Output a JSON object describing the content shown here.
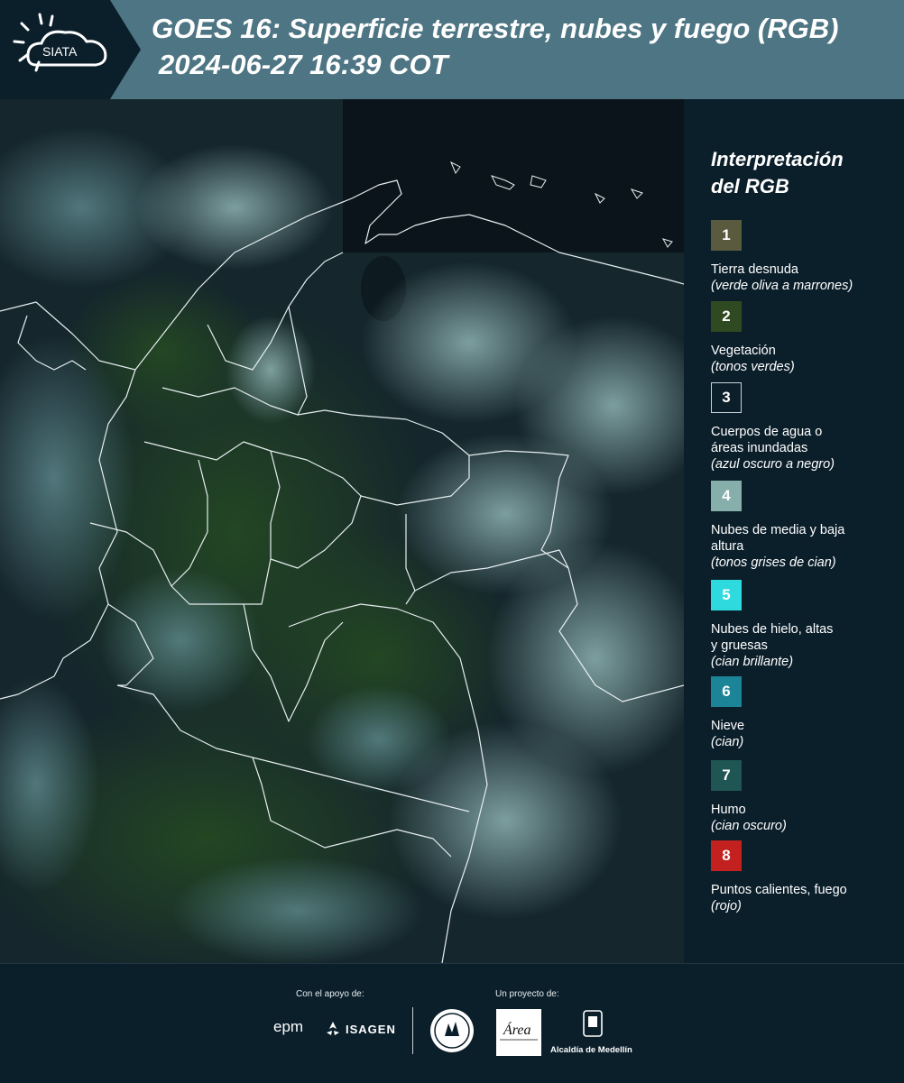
{
  "header": {
    "logo_text": "SIATA",
    "title": "GOES 16: Superficie terrestre, nubes y fuego (RGB)",
    "subtitle": "2024-06-27 16:39 COT"
  },
  "legend": {
    "title_line1": "Interpretación",
    "title_line2": "del RGB",
    "items": [
      {
        "num": "1",
        "label": "Tierra desnuda",
        "desc": "(verde oliva a marrones)",
        "color": "#5a5a3e"
      },
      {
        "num": "2",
        "label": "Vegetación",
        "desc": "(tonos verdes)",
        "color": "#2f4a21"
      },
      {
        "num": "3",
        "label": "Cuerpos de agua o áreas inundadas",
        "desc": "(azul oscuro a negro)",
        "color": "#0b1f2b"
      },
      {
        "num": "4",
        "label": "Nubes de media y baja altura",
        "desc": "(tonos grises de cian)",
        "color": "#86aeab"
      },
      {
        "num": "5",
        "label": "Nubes de hielo, altas y gruesas",
        "desc": "(cian brillante)",
        "color": "#2fdadf"
      },
      {
        "num": "6",
        "label": "Nieve",
        "desc": "(cian)",
        "color": "#1c8497"
      },
      {
        "num": "7",
        "label": "Humo",
        "desc": "(cian oscuro)",
        "color": "#1f5553"
      },
      {
        "num": "8",
        "label": "Puntos calientes, fuego",
        "desc": "(rojo)",
        "color": "#c3211f"
      }
    ]
  },
  "footer": {
    "support_label": "Con el apoyo de:",
    "project_label": "Un proyecto de:",
    "sponsor1": "epm",
    "sponsor2": "ISAGEN",
    "partner_area": "Área",
    "partner_alcaldia": "Alcaldía de Medellín"
  }
}
